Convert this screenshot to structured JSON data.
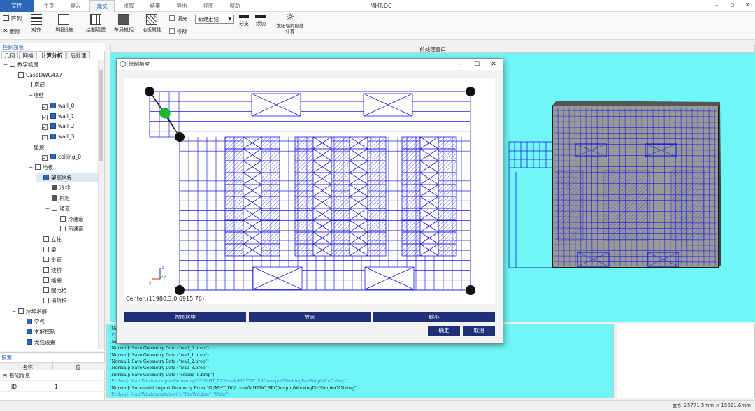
{
  "app": {
    "title": "MHT.DC",
    "file_tab": "文件"
  },
  "ribbon_tabs": [
    "主页",
    "导入",
    "建筑",
    "求解",
    "结果",
    "导出",
    "视图",
    "帮助"
  ],
  "ribbon_active_tab": "建筑",
  "window_controls": {
    "minimize": "–",
    "restore": "▫",
    "close": "✕"
  },
  "ribbon": {
    "array": "阵列",
    "delete": "删除",
    "align": "对齐",
    "detail_devices": "详细设施",
    "draw_wall": "绘制墙壁",
    "layout_cabinet": "布局机柜",
    "floor_props": "地板属性",
    "fill": "填充",
    "remove": "移除",
    "line_select": "新建走线",
    "branch": "分支",
    "continue": "续加",
    "solar_calc": "太阳辐射照度计算"
  },
  "left_panel": {
    "title": "控制面板",
    "tabs": [
      "几何",
      "网格",
      "计算分析",
      "后处理"
    ],
    "active_tab": "计算分析"
  },
  "tree": [
    {
      "label": "数字机房",
      "level": 0,
      "exp": "−",
      "icon": "tree-icon"
    },
    {
      "label": "CaseDWG4X7",
      "level": 1,
      "exp": "−",
      "icon": "case-icon"
    },
    {
      "label": "房间",
      "level": 2,
      "exp": "−",
      "icon": "cube-icon"
    },
    {
      "label": "墙壁",
      "level": 3,
      "exp": "−",
      "icon": "none"
    },
    {
      "label": "wall_0",
      "level": 4,
      "exp": "",
      "icon": "wall-icon",
      "check": true
    },
    {
      "label": "wall_1",
      "level": 4,
      "exp": "",
      "icon": "wall-icon",
      "check": true
    },
    {
      "label": "wall_2",
      "level": 4,
      "exp": "",
      "icon": "wall-icon",
      "check": true
    },
    {
      "label": "wall_3",
      "level": 4,
      "exp": "",
      "icon": "wall-icon",
      "check": true
    },
    {
      "label": "屋顶",
      "level": 3,
      "exp": "−",
      "icon": "none"
    },
    {
      "label": "ceiling_0",
      "level": 4,
      "exp": "",
      "icon": "wall-icon",
      "check": true
    },
    {
      "label": "地板",
      "level": 3,
      "exp": "−",
      "icon": "floor-icon"
    },
    {
      "label": "架高地板",
      "level": 4,
      "exp": "−",
      "icon": "raised-floor-icon",
      "selected": true
    },
    {
      "label": "冷却",
      "level": 5,
      "exp": "",
      "icon": "cooler-icon"
    },
    {
      "label": "机柜",
      "level": 5,
      "exp": "",
      "icon": "cabinet-icon"
    },
    {
      "label": "通道",
      "level": 5,
      "exp": "−",
      "icon": "channel-icon"
    },
    {
      "label": "冷通道",
      "level": 6,
      "exp": "",
      "icon": "channel-icon"
    },
    {
      "label": "热通道",
      "level": 6,
      "exp": "",
      "icon": "channel-icon"
    },
    {
      "label": "立柱",
      "level": 4,
      "exp": "",
      "icon": "cube-icon"
    },
    {
      "label": "梁",
      "level": 4,
      "exp": "",
      "icon": "cube-icon"
    },
    {
      "label": "水管",
      "level": 4,
      "exp": "",
      "icon": "cube-icon"
    },
    {
      "label": "线桥",
      "level": 4,
      "exp": "",
      "icon": "cube-icon"
    },
    {
      "label": "格栅",
      "level": 4,
      "exp": "",
      "icon": "cube-icon"
    },
    {
      "label": "配电柜",
      "level": 4,
      "exp": "",
      "icon": "cube-icon"
    },
    {
      "label": "消防柜",
      "level": 4,
      "exp": "",
      "icon": "cube-icon"
    },
    {
      "label": "冷却求解",
      "level": 1,
      "exp": "−",
      "icon": "cube-icon"
    },
    {
      "label": "空气",
      "level": 2,
      "exp": "",
      "icon": "play-icon"
    },
    {
      "label": "求解控制",
      "level": 2,
      "exp": "",
      "icon": "play-icon"
    },
    {
      "label": "流线设置",
      "level": 2,
      "exp": "",
      "icon": "play-icon"
    }
  ],
  "settings": {
    "title": "设置",
    "col_name": "名称",
    "col_value": "值",
    "group": "基础信息",
    "rows": [
      {
        "name": "ID",
        "value": "1"
      }
    ]
  },
  "viewport": {
    "header": "前处理窗口"
  },
  "dialog": {
    "title": "绘制墙壁",
    "center_text": "Center:(11980.3,0,6915.76)",
    "btn_center": "视图居中",
    "btn_zoom_in": "放大",
    "btn_zoom_out": "缩小",
    "btn_ok": "确定",
    "btn_cancel": "取消",
    "axis_z": "z",
    "axis_y": "y",
    "axis_x": "x"
  },
  "console_lines": [
    {
      "text": "[Normal]: ",
      "type": "n"
    },
    {
      "text": "[Python]: ",
      "type": "p"
    },
    {
      "text": "[Normal]: ",
      "type": "n"
    },
    {
      "text": "[Normal]: Save Geometry Data (\"wall_0.brep\")",
      "type": "n"
    },
    {
      "text": "[Normal]: Save Geometry Data (\"wall_1.brep\")",
      "type": "n"
    },
    {
      "text": "[Normal]: Save Geometry Data (\"wall_2.brep\")",
      "type": "n"
    },
    {
      "text": "[Normal]: Save Geometry Data (\"wall_3.brep\")",
      "type": "n"
    },
    {
      "text": "[Normal]: Save Geometry Data (\"ceiling_0.brep\")",
      "type": "n"
    },
    {
      "text": "[Python]: MainWindow.importGeometry(\"G:/MHT_DC/trunk/MHTDC_SRC/output/WorkingDir/SimpleCAD.dwg\")",
      "type": "p"
    },
    {
      "text": "[Normal]: Successful Import Geometry From \"G:/MHT_DC/trunk/MHTDC_SRC/output/WorkingDir/SimpleCAD.dwg\"",
      "type": "n"
    },
    {
      "text": "[Python]: MainWindow.setView(-1,\"PreWindow\",\"XYiso\")",
      "type": "p"
    }
  ],
  "status": "面积  25771.5mm × 15621.6mm",
  "colors": {
    "accent": "#2b66b7",
    "cad_line": "#1d1de0",
    "viewport_bg": "#6ff6f6",
    "dialog_button": "#1f2f78",
    "node_active": "#1fb81f"
  }
}
